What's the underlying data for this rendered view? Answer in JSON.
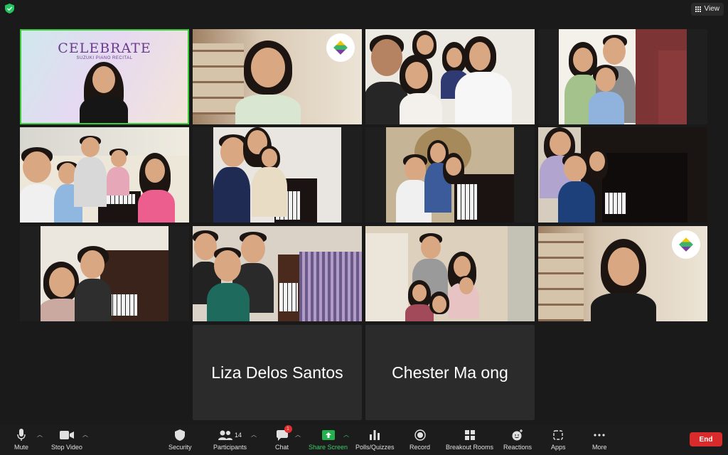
{
  "topbar": {
    "view_label": "View"
  },
  "tiles_named": [
    {
      "name": "Liza Delos Santos"
    },
    {
      "name": "Chester Ma ong"
    }
  ],
  "celebrate": {
    "title": "CELEBRATE",
    "subtitle": "SUZUKI PIANO RECITAL"
  },
  "toolbar": {
    "mute": "Mute",
    "stop_video": "Stop Video",
    "security": "Security",
    "participants": "Participants",
    "participants_count": "14",
    "chat": "Chat",
    "chat_badge": "1",
    "share_screen": "Share Screen",
    "polls": "Polls/Quizzes",
    "record": "Record",
    "breakout": "Breakout Rooms",
    "reactions": "Reactions",
    "apps": "Apps",
    "more": "More",
    "end": "End"
  },
  "colors": {
    "active_border": "#3ccf3c",
    "share_green": "#23b14d",
    "end_red": "#d92b2b"
  }
}
